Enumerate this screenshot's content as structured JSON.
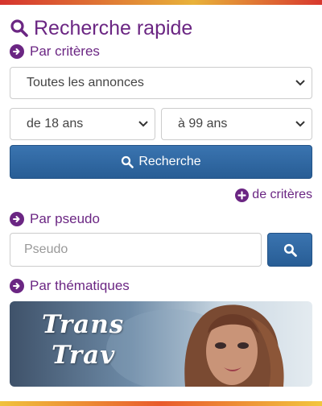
{
  "header": {
    "title": "Recherche rapide"
  },
  "criteria": {
    "label": "Par critères",
    "ads_select": "Toutes les annonces",
    "age_from": "de 18 ans",
    "age_to": "à 99 ans",
    "search_button": "Recherche",
    "more_link": "de critères"
  },
  "pseudo": {
    "label": "Par pseudo",
    "placeholder": "Pseudo"
  },
  "themes": {
    "label": "Par thématiques",
    "banner_line1": "Trans",
    "banner_line2": "Trav"
  },
  "colors": {
    "accent_purple": "#6b2683",
    "button_blue": "#2f689f"
  },
  "icons": [
    "search-icon",
    "arrow-circle-right-icon",
    "plus-circle-icon",
    "chevron-down-icon"
  ]
}
